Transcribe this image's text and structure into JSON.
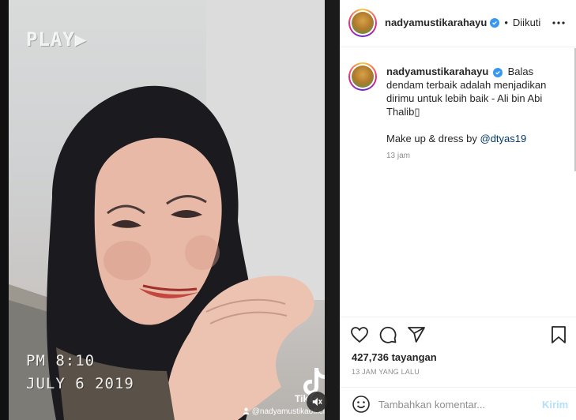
{
  "video": {
    "vhs_label": "PLAY▶",
    "vhs_time": "PM 8:10",
    "vhs_date": "JULY  6  2019",
    "watermark_brand": "TikTok",
    "watermark_handle": "@nadyamustikaofficial"
  },
  "header": {
    "username": "nadyamustikarahayu",
    "separator": "•",
    "follow_state": "Diikuti",
    "more_icon": "more-horizontal-icon"
  },
  "caption": {
    "username": "nadyamustikarahayu",
    "text": "Balas dendam terbaik adalah menjadikan dirimu untuk lebih baik - Ali bin Abi Thalib▯",
    "line2_prefix": "Make up & dress by ",
    "mention": "@dtyas19",
    "age": "13 jam"
  },
  "actions": {
    "icons": [
      "heart-icon",
      "comment-icon",
      "share-icon",
      "bookmark-icon"
    ],
    "views": "427,736 tayangan",
    "time_ago": "13 JAM YANG LALU"
  },
  "comment": {
    "placeholder": "Tambahkan komentar...",
    "post_label": "Kirim",
    "post_color": "#b2dffc"
  },
  "colors": {
    "verified": "#3897f0",
    "mention": "#00376b",
    "muted": "#8e8e8e"
  }
}
